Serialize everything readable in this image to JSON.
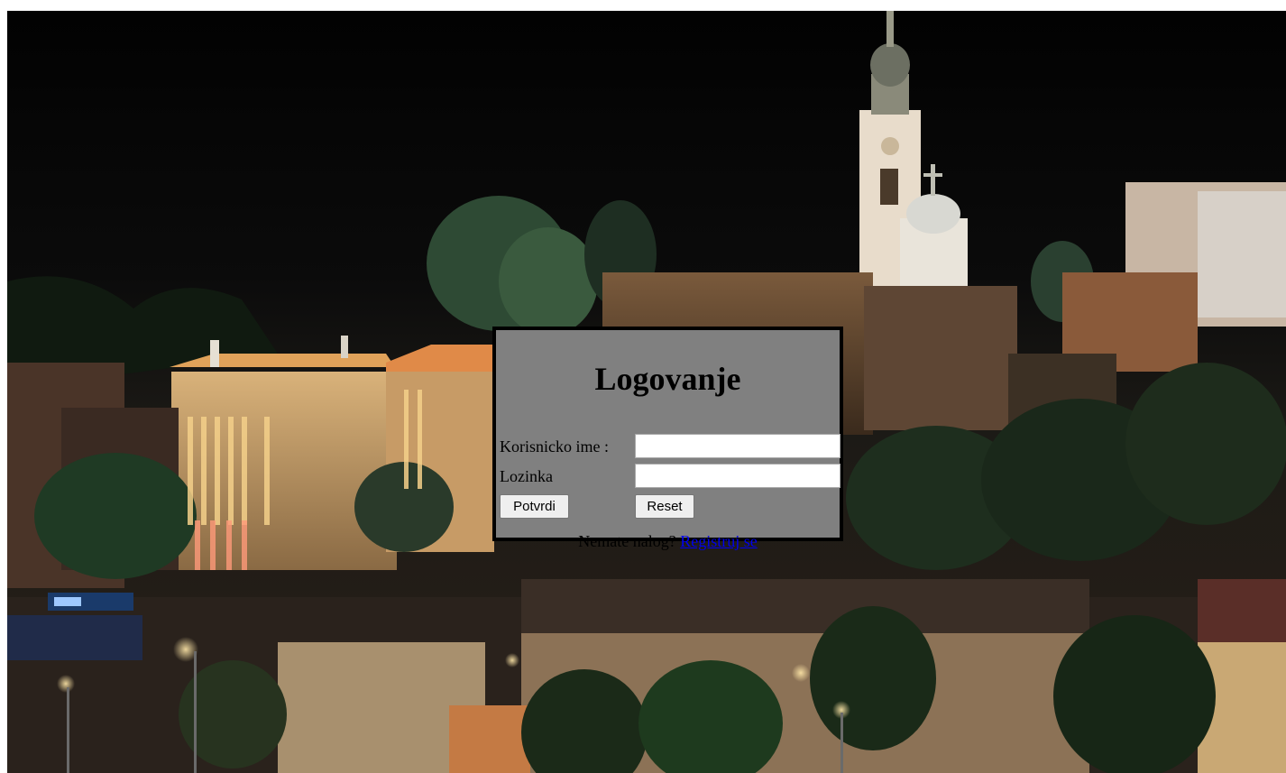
{
  "login": {
    "title": "Logovanje",
    "username_label": "Korisnicko ime :",
    "username_value": "",
    "password_label": "Lozinka",
    "password_value": "",
    "submit_label": "Potvrdi",
    "reset_label": "Reset",
    "no_account_text": "Nemate nalog?",
    "register_link": "Registruj se"
  },
  "colors": {
    "panel_background": "#808080",
    "panel_border": "#000000",
    "link": "#0000ee"
  }
}
